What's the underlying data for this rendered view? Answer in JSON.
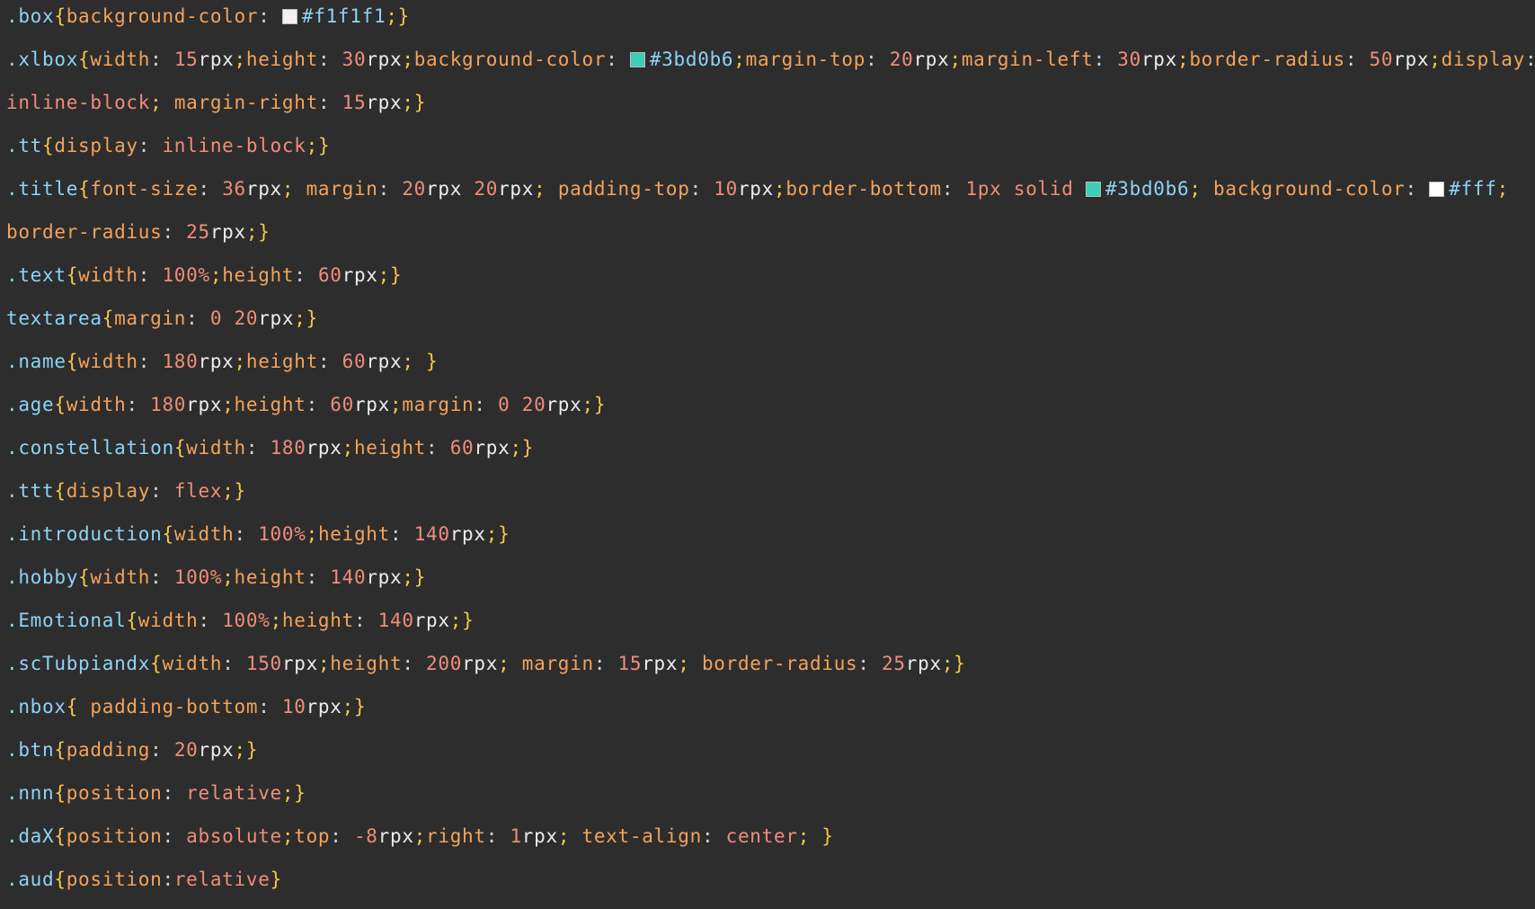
{
  "editor": {
    "theme": {
      "background": "#2d2d2d",
      "selector": "#8ed3f6",
      "brace": "#f7c74a",
      "property": "#f4a35a",
      "number": "#f08d7a",
      "unit": "#ededed",
      "keyword": "#f08d7a",
      "hex": "#8ed3f6"
    },
    "lines": [
      [
        {
          "t": "selector",
          "v": ".box"
        },
        {
          "t": "brace",
          "v": "{"
        },
        {
          "t": "prop",
          "v": "background-color"
        },
        {
          "t": "punct",
          "v": ": "
        },
        {
          "t": "swatch",
          "c": "#f1f1f1"
        },
        {
          "t": "hex",
          "v": "#f1f1f1"
        },
        {
          "t": "semi",
          "v": ";"
        },
        {
          "t": "brace",
          "v": "}"
        }
      ],
      [
        {
          "t": "selector",
          "v": ".xlbox"
        },
        {
          "t": "brace",
          "v": "{"
        },
        {
          "t": "prop",
          "v": "width"
        },
        {
          "t": "punct",
          "v": ": "
        },
        {
          "t": "num",
          "v": "15"
        },
        {
          "t": "unit",
          "v": "rpx"
        },
        {
          "t": "semi",
          "v": ";"
        },
        {
          "t": "prop",
          "v": "height"
        },
        {
          "t": "punct",
          "v": ": "
        },
        {
          "t": "num",
          "v": "30"
        },
        {
          "t": "unit",
          "v": "rpx"
        },
        {
          "t": "semi",
          "v": ";"
        },
        {
          "t": "prop",
          "v": "background-color"
        },
        {
          "t": "punct",
          "v": ": "
        },
        {
          "t": "swatch",
          "c": "#3bd0b6"
        },
        {
          "t": "hex",
          "v": "#3bd0b6"
        },
        {
          "t": "semi",
          "v": ";"
        },
        {
          "t": "prop",
          "v": "margin-top"
        },
        {
          "t": "punct",
          "v": ": "
        },
        {
          "t": "num",
          "v": "20"
        },
        {
          "t": "unit",
          "v": "rpx"
        },
        {
          "t": "semi",
          "v": ";"
        },
        {
          "t": "prop",
          "v": "margin-left"
        },
        {
          "t": "punct",
          "v": ": "
        },
        {
          "t": "num",
          "v": "30"
        },
        {
          "t": "unit",
          "v": "rpx"
        },
        {
          "t": "semi",
          "v": ";"
        },
        {
          "t": "prop",
          "v": "border-radius"
        },
        {
          "t": "punct",
          "v": ": "
        },
        {
          "t": "num",
          "v": "50"
        },
        {
          "t": "unit",
          "v": "rpx"
        },
        {
          "t": "semi",
          "v": ";"
        },
        {
          "t": "prop",
          "v": "display"
        },
        {
          "t": "punct",
          "v": ":"
        }
      ],
      [
        {
          "t": "kw",
          "v": "inline-block"
        },
        {
          "t": "semi",
          "v": ";"
        },
        {
          "t": "punct",
          "v": " "
        },
        {
          "t": "prop",
          "v": "margin-right"
        },
        {
          "t": "punct",
          "v": ": "
        },
        {
          "t": "num",
          "v": "15"
        },
        {
          "t": "unit",
          "v": "rpx"
        },
        {
          "t": "semi",
          "v": ";"
        },
        {
          "t": "brace",
          "v": "}"
        }
      ],
      [
        {
          "t": "selector",
          "v": ".tt"
        },
        {
          "t": "brace",
          "v": "{"
        },
        {
          "t": "prop",
          "v": "display"
        },
        {
          "t": "punct",
          "v": ": "
        },
        {
          "t": "kw",
          "v": "inline-block"
        },
        {
          "t": "semi",
          "v": ";"
        },
        {
          "t": "brace",
          "v": "}"
        }
      ],
      [
        {
          "t": "selector",
          "v": ".title"
        },
        {
          "t": "brace",
          "v": "{"
        },
        {
          "t": "prop",
          "v": "font-size"
        },
        {
          "t": "punct",
          "v": ": "
        },
        {
          "t": "num",
          "v": "36"
        },
        {
          "t": "unit",
          "v": "rpx"
        },
        {
          "t": "semi",
          "v": ";"
        },
        {
          "t": "punct",
          "v": " "
        },
        {
          "t": "prop",
          "v": "margin"
        },
        {
          "t": "punct",
          "v": ": "
        },
        {
          "t": "num",
          "v": "20"
        },
        {
          "t": "unit",
          "v": "rpx"
        },
        {
          "t": "punct",
          "v": " "
        },
        {
          "t": "num",
          "v": "20"
        },
        {
          "t": "unit",
          "v": "rpx"
        },
        {
          "t": "semi",
          "v": ";"
        },
        {
          "t": "punct",
          "v": " "
        },
        {
          "t": "prop",
          "v": "padding-top"
        },
        {
          "t": "punct",
          "v": ": "
        },
        {
          "t": "num",
          "v": "10"
        },
        {
          "t": "unit",
          "v": "rpx"
        },
        {
          "t": "semi",
          "v": ";"
        },
        {
          "t": "prop",
          "v": "border-bottom"
        },
        {
          "t": "punct",
          "v": ": "
        },
        {
          "t": "num",
          "v": "1px"
        },
        {
          "t": "punct",
          "v": " "
        },
        {
          "t": "kw",
          "v": "solid"
        },
        {
          "t": "punct",
          "v": " "
        },
        {
          "t": "swatch",
          "c": "#3bd0b6"
        },
        {
          "t": "hex",
          "v": "#3bd0b6"
        },
        {
          "t": "semi",
          "v": ";"
        },
        {
          "t": "punct",
          "v": " "
        },
        {
          "t": "prop",
          "v": "background-color"
        },
        {
          "t": "punct",
          "v": ": "
        },
        {
          "t": "swatch",
          "c": "#ffffff"
        },
        {
          "t": "hex",
          "v": "#fff"
        },
        {
          "t": "semi",
          "v": ";"
        }
      ],
      [
        {
          "t": "prop",
          "v": "border-radius"
        },
        {
          "t": "punct",
          "v": ": "
        },
        {
          "t": "num",
          "v": "25"
        },
        {
          "t": "unit",
          "v": "rpx"
        },
        {
          "t": "semi",
          "v": ";"
        },
        {
          "t": "brace",
          "v": "}"
        }
      ],
      [
        {
          "t": "selector",
          "v": ".text"
        },
        {
          "t": "brace",
          "v": "{"
        },
        {
          "t": "prop",
          "v": "width"
        },
        {
          "t": "punct",
          "v": ": "
        },
        {
          "t": "num",
          "v": "100%"
        },
        {
          "t": "semi",
          "v": ";"
        },
        {
          "t": "prop",
          "v": "height"
        },
        {
          "t": "punct",
          "v": ": "
        },
        {
          "t": "num",
          "v": "60"
        },
        {
          "t": "unit",
          "v": "rpx"
        },
        {
          "t": "semi",
          "v": ";"
        },
        {
          "t": "brace",
          "v": "}"
        }
      ],
      [
        {
          "t": "selector",
          "v": "textarea"
        },
        {
          "t": "brace",
          "v": "{"
        },
        {
          "t": "prop",
          "v": "margin"
        },
        {
          "t": "punct",
          "v": ": "
        },
        {
          "t": "num",
          "v": "0"
        },
        {
          "t": "punct",
          "v": " "
        },
        {
          "t": "num",
          "v": "20"
        },
        {
          "t": "unit",
          "v": "rpx"
        },
        {
          "t": "semi",
          "v": ";"
        },
        {
          "t": "brace",
          "v": "}"
        }
      ],
      [
        {
          "t": "selector",
          "v": ".name"
        },
        {
          "t": "brace",
          "v": "{"
        },
        {
          "t": "prop",
          "v": "width"
        },
        {
          "t": "punct",
          "v": ": "
        },
        {
          "t": "num",
          "v": "180"
        },
        {
          "t": "unit",
          "v": "rpx"
        },
        {
          "t": "semi",
          "v": ";"
        },
        {
          "t": "prop",
          "v": "height"
        },
        {
          "t": "punct",
          "v": ": "
        },
        {
          "t": "num",
          "v": "60"
        },
        {
          "t": "unit",
          "v": "rpx"
        },
        {
          "t": "semi",
          "v": ";"
        },
        {
          "t": "punct",
          "v": " "
        },
        {
          "t": "brace",
          "v": "}"
        }
      ],
      [
        {
          "t": "selector",
          "v": ".age"
        },
        {
          "t": "brace",
          "v": "{"
        },
        {
          "t": "prop",
          "v": "width"
        },
        {
          "t": "punct",
          "v": ": "
        },
        {
          "t": "num",
          "v": "180"
        },
        {
          "t": "unit",
          "v": "rpx"
        },
        {
          "t": "semi",
          "v": ";"
        },
        {
          "t": "prop",
          "v": "height"
        },
        {
          "t": "punct",
          "v": ": "
        },
        {
          "t": "num",
          "v": "60"
        },
        {
          "t": "unit",
          "v": "rpx"
        },
        {
          "t": "semi",
          "v": ";"
        },
        {
          "t": "prop",
          "v": "margin"
        },
        {
          "t": "punct",
          "v": ": "
        },
        {
          "t": "num",
          "v": "0"
        },
        {
          "t": "punct",
          "v": " "
        },
        {
          "t": "num",
          "v": "20"
        },
        {
          "t": "unit",
          "v": "rpx"
        },
        {
          "t": "semi",
          "v": ";"
        },
        {
          "t": "brace",
          "v": "}"
        }
      ],
      [
        {
          "t": "selector",
          "v": ".constellation"
        },
        {
          "t": "brace",
          "v": "{"
        },
        {
          "t": "prop",
          "v": "width"
        },
        {
          "t": "punct",
          "v": ": "
        },
        {
          "t": "num",
          "v": "180"
        },
        {
          "t": "unit",
          "v": "rpx"
        },
        {
          "t": "semi",
          "v": ";"
        },
        {
          "t": "prop",
          "v": "height"
        },
        {
          "t": "punct",
          "v": ": "
        },
        {
          "t": "num",
          "v": "60"
        },
        {
          "t": "unit",
          "v": "rpx"
        },
        {
          "t": "semi",
          "v": ";"
        },
        {
          "t": "brace",
          "v": "}"
        }
      ],
      [
        {
          "t": "selector",
          "v": ".ttt"
        },
        {
          "t": "brace",
          "v": "{"
        },
        {
          "t": "prop",
          "v": "display"
        },
        {
          "t": "punct",
          "v": ": "
        },
        {
          "t": "kw",
          "v": "flex"
        },
        {
          "t": "semi",
          "v": ";"
        },
        {
          "t": "brace",
          "v": "}"
        }
      ],
      [
        {
          "t": "selector",
          "v": ".introduction"
        },
        {
          "t": "brace",
          "v": "{"
        },
        {
          "t": "prop",
          "v": "width"
        },
        {
          "t": "punct",
          "v": ": "
        },
        {
          "t": "num",
          "v": "100%"
        },
        {
          "t": "semi",
          "v": ";"
        },
        {
          "t": "prop",
          "v": "height"
        },
        {
          "t": "punct",
          "v": ": "
        },
        {
          "t": "num",
          "v": "140"
        },
        {
          "t": "unit",
          "v": "rpx"
        },
        {
          "t": "semi",
          "v": ";"
        },
        {
          "t": "brace",
          "v": "}"
        }
      ],
      [
        {
          "t": "selector",
          "v": ".hobby"
        },
        {
          "t": "brace",
          "v": "{"
        },
        {
          "t": "prop",
          "v": "width"
        },
        {
          "t": "punct",
          "v": ": "
        },
        {
          "t": "num",
          "v": "100%"
        },
        {
          "t": "semi",
          "v": ";"
        },
        {
          "t": "prop",
          "v": "height"
        },
        {
          "t": "punct",
          "v": ": "
        },
        {
          "t": "num",
          "v": "140"
        },
        {
          "t": "unit",
          "v": "rpx"
        },
        {
          "t": "semi",
          "v": ";"
        },
        {
          "t": "brace",
          "v": "}"
        }
      ],
      [
        {
          "t": "selector",
          "v": ".Emotional"
        },
        {
          "t": "brace",
          "v": "{"
        },
        {
          "t": "prop",
          "v": "width"
        },
        {
          "t": "punct",
          "v": ": "
        },
        {
          "t": "num",
          "v": "100%"
        },
        {
          "t": "semi",
          "v": ";"
        },
        {
          "t": "prop",
          "v": "height"
        },
        {
          "t": "punct",
          "v": ": "
        },
        {
          "t": "num",
          "v": "140"
        },
        {
          "t": "unit",
          "v": "rpx"
        },
        {
          "t": "semi",
          "v": ";"
        },
        {
          "t": "brace",
          "v": "}"
        }
      ],
      [
        {
          "t": "selector",
          "v": ".scTubpiandx"
        },
        {
          "t": "brace",
          "v": "{"
        },
        {
          "t": "prop",
          "v": "width"
        },
        {
          "t": "punct",
          "v": ": "
        },
        {
          "t": "num",
          "v": "150"
        },
        {
          "t": "unit",
          "v": "rpx"
        },
        {
          "t": "semi",
          "v": ";"
        },
        {
          "t": "prop",
          "v": "height"
        },
        {
          "t": "punct",
          "v": ": "
        },
        {
          "t": "num",
          "v": "200"
        },
        {
          "t": "unit",
          "v": "rpx"
        },
        {
          "t": "semi",
          "v": ";"
        },
        {
          "t": "punct",
          "v": " "
        },
        {
          "t": "prop",
          "v": "margin"
        },
        {
          "t": "punct",
          "v": ": "
        },
        {
          "t": "num",
          "v": "15"
        },
        {
          "t": "unit",
          "v": "rpx"
        },
        {
          "t": "semi",
          "v": ";"
        },
        {
          "t": "punct",
          "v": " "
        },
        {
          "t": "prop",
          "v": "border-radius"
        },
        {
          "t": "punct",
          "v": ": "
        },
        {
          "t": "num",
          "v": "25"
        },
        {
          "t": "unit",
          "v": "rpx"
        },
        {
          "t": "semi",
          "v": ";"
        },
        {
          "t": "brace",
          "v": "}"
        }
      ],
      [
        {
          "t": "selector",
          "v": ".nbox"
        },
        {
          "t": "brace",
          "v": "{"
        },
        {
          "t": "punct",
          "v": " "
        },
        {
          "t": "prop",
          "v": "padding-bottom"
        },
        {
          "t": "punct",
          "v": ": "
        },
        {
          "t": "num",
          "v": "10"
        },
        {
          "t": "unit",
          "v": "rpx"
        },
        {
          "t": "semi",
          "v": ";"
        },
        {
          "t": "brace",
          "v": "}"
        }
      ],
      [
        {
          "t": "selector",
          "v": ".btn"
        },
        {
          "t": "brace",
          "v": "{"
        },
        {
          "t": "prop",
          "v": "padding"
        },
        {
          "t": "punct",
          "v": ": "
        },
        {
          "t": "num",
          "v": "20"
        },
        {
          "t": "unit",
          "v": "rpx"
        },
        {
          "t": "semi",
          "v": ";"
        },
        {
          "t": "brace",
          "v": "}"
        }
      ],
      [
        {
          "t": "selector",
          "v": ".nnn"
        },
        {
          "t": "brace",
          "v": "{"
        },
        {
          "t": "prop",
          "v": "position"
        },
        {
          "t": "punct",
          "v": ": "
        },
        {
          "t": "kw",
          "v": "relative"
        },
        {
          "t": "semi",
          "v": ";"
        },
        {
          "t": "brace",
          "v": "}"
        }
      ],
      [
        {
          "t": "selector",
          "v": ".daX"
        },
        {
          "t": "brace",
          "v": "{"
        },
        {
          "t": "prop",
          "v": "position"
        },
        {
          "t": "punct",
          "v": ": "
        },
        {
          "t": "kw",
          "v": "absolute"
        },
        {
          "t": "semi",
          "v": ";"
        },
        {
          "t": "prop",
          "v": "top"
        },
        {
          "t": "punct",
          "v": ": "
        },
        {
          "t": "num",
          "v": "-8"
        },
        {
          "t": "unit",
          "v": "rpx"
        },
        {
          "t": "semi",
          "v": ";"
        },
        {
          "t": "prop",
          "v": "right"
        },
        {
          "t": "punct",
          "v": ": "
        },
        {
          "t": "num",
          "v": "1"
        },
        {
          "t": "unit",
          "v": "rpx"
        },
        {
          "t": "semi",
          "v": ";"
        },
        {
          "t": "punct",
          "v": " "
        },
        {
          "t": "prop",
          "v": "text-align"
        },
        {
          "t": "punct",
          "v": ": "
        },
        {
          "t": "kw",
          "v": "center"
        },
        {
          "t": "semi",
          "v": ";"
        },
        {
          "t": "punct",
          "v": " "
        },
        {
          "t": "brace",
          "v": "}"
        }
      ],
      [
        {
          "t": "selector",
          "v": ".aud"
        },
        {
          "t": "brace",
          "v": "{"
        },
        {
          "t": "prop",
          "v": "position"
        },
        {
          "t": "punct",
          "v": ":"
        },
        {
          "t": "kw",
          "v": "relative"
        },
        {
          "t": "brace",
          "v": "}"
        }
      ]
    ]
  }
}
